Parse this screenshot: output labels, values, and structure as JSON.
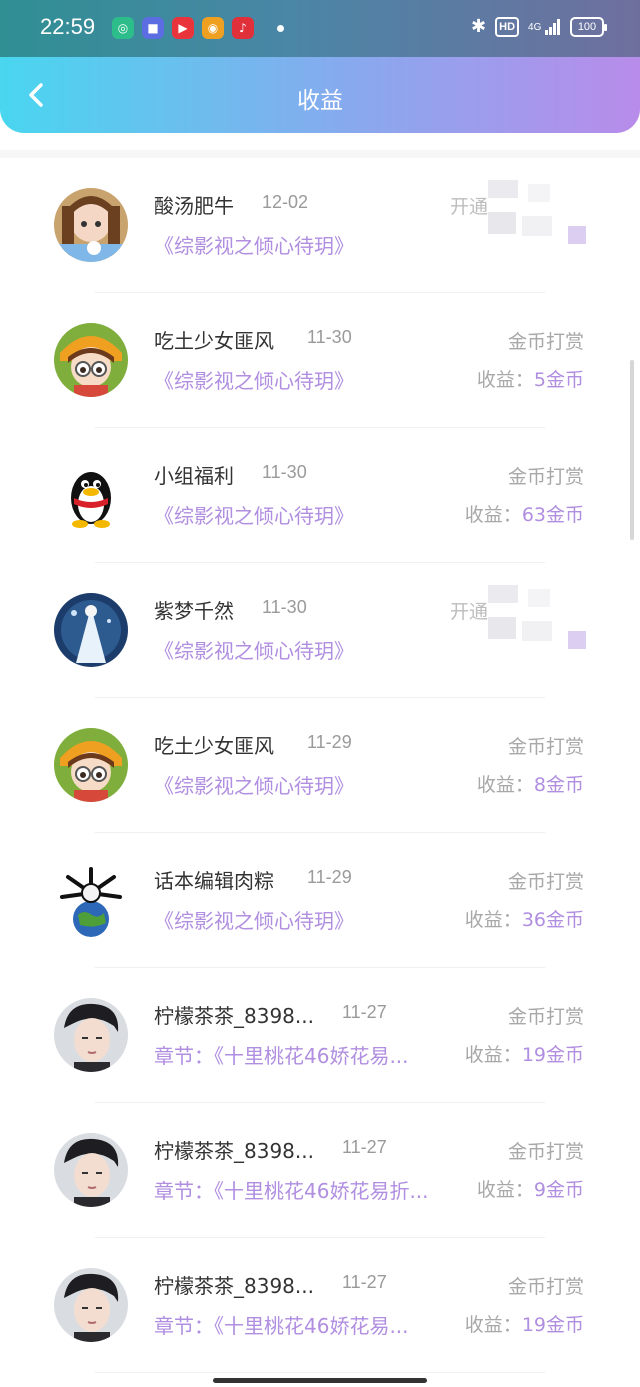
{
  "status_bar": {
    "time": "22:59",
    "network": "4G",
    "hd_label": "HD",
    "battery": "100"
  },
  "header": {
    "title": "收益"
  },
  "rows": [
    {
      "name": "酸汤肥牛",
      "date": "12-02",
      "book": "《综影视之倾心待玥》",
      "type": "开通",
      "income_label": "",
      "income_value": "",
      "blurred": true
    },
    {
      "name": "吃土少女匪风",
      "date": "11-30",
      "book": "《综影视之倾心待玥》",
      "type": "金币打赏",
      "income_label": "收益：",
      "income_value": "5金币",
      "blurred": false
    },
    {
      "name": "小组福利",
      "date": "11-30",
      "book": "《综影视之倾心待玥》",
      "type": "金币打赏",
      "income_label": "收益：",
      "income_value": "63金币",
      "blurred": false
    },
    {
      "name": "紫梦千然",
      "date": "11-30",
      "book": "《综影视之倾心待玥》",
      "type": "开通",
      "income_label": "",
      "income_value": "",
      "blurred": true
    },
    {
      "name": "吃土少女匪风",
      "date": "11-29",
      "book": "《综影视之倾心待玥》",
      "type": "金币打赏",
      "income_label": "收益：",
      "income_value": "8金币",
      "blurred": false
    },
    {
      "name": "话本编辑肉粽",
      "date": "11-29",
      "book": "《综影视之倾心待玥》",
      "type": "金币打赏",
      "income_label": "收益：",
      "income_value": "36金币",
      "blurred": false
    },
    {
      "name": "柠檬茶茶_8398...",
      "date": "11-27",
      "book": "章节：《十里桃花46娇花易...",
      "type": "金币打赏",
      "income_label": "收益：",
      "income_value": "19金币",
      "blurred": false
    },
    {
      "name": "柠檬茶茶_8398...",
      "date": "11-27",
      "book": "章节：《十里桃花46娇花易折...",
      "type": "金币打赏",
      "income_label": "收益：",
      "income_value": "9金币",
      "blurred": false
    },
    {
      "name": "柠檬茶茶_8398...",
      "date": "11-27",
      "book": "章节：《十里桃花46娇花易...",
      "type": "金币打赏",
      "income_label": "收益：",
      "income_value": "19金币",
      "blurred": false
    }
  ]
}
